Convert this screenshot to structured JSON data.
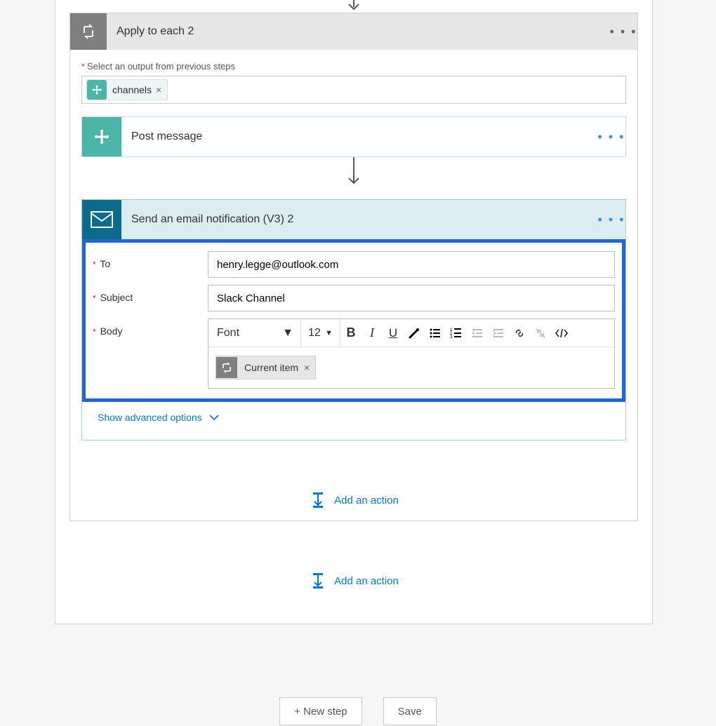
{
  "foreach": {
    "title": "Apply to each 2",
    "outputs_label": "Select an output from previous steps",
    "token_label": "channels"
  },
  "slack_card": {
    "title": "Post message"
  },
  "email_card": {
    "title": "Send an email notification (V3) 2",
    "fields": {
      "to_label": "To",
      "to_value": "henry.legge@outlook.com",
      "subject_label": "Subject",
      "subject_value": "Slack Channel",
      "body_label": "Body"
    },
    "editor": {
      "font_label": "Font",
      "size_label": "12",
      "body_token": "Current item"
    },
    "advanced_label": "Show advanced options"
  },
  "add_action_label": "Add an action",
  "buttons": {
    "new_step": "+ New step",
    "save": "Save"
  }
}
